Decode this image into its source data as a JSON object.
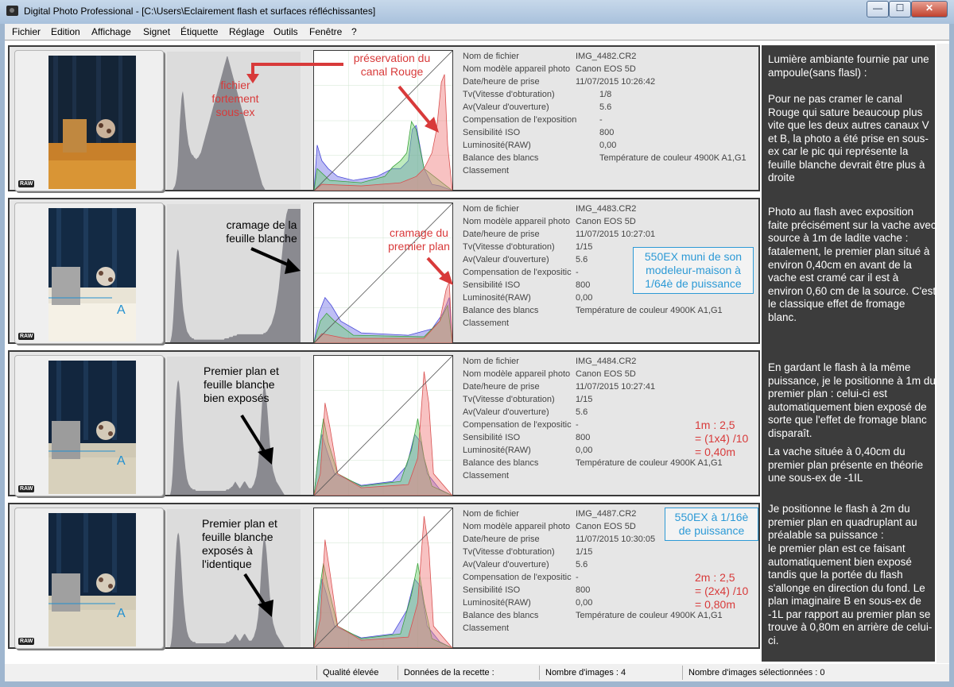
{
  "window": {
    "title": "Digital Photo Professional - [C:\\Users\\Eclairement flash et surfaces réfléchissantes]"
  },
  "window_controls": {
    "minimize": "—",
    "maximize": "☐",
    "close": "✕"
  },
  "menu": [
    "Fichier",
    "Edition",
    "Affichage",
    "Signet",
    "Étiquette",
    "Réglage",
    "Outils",
    "Fenêtre",
    "?"
  ],
  "labels": {
    "file": "Nom de fichier",
    "model": "Nom modèle appareil photo",
    "date": "Date/heure de prise",
    "tv": "Tv(Vitesse d'obturation)",
    "av": "Av(Valeur d'ouverture)",
    "comp_full": "Compensation de l'exposition",
    "comp_short": "Compensation de l'expositic",
    "iso": "Sensibilité ISO",
    "lum": "Luminosité(RAW)",
    "wb": "Balance des blancs",
    "rating": "Classement"
  },
  "raw_badge": "RAW",
  "marker_letter": "A",
  "images": [
    {
      "file": "IMG_4482.CR2",
      "model": "Canon EOS 5D",
      "date": "11/07/2015 10:26:42",
      "tv": "1/8",
      "av": "5.6",
      "comp": "-",
      "iso": "800",
      "lum": "0,00",
      "wb": "Température de couleur 4900K A1,G1",
      "rating": "",
      "ann_hist1": "fichier fortement sous-ex",
      "ann_hist2": "préservation du canal Rouge"
    },
    {
      "file": "IMG_4483.CR2",
      "model": "Canon EOS 5D",
      "date": "11/07/2015 10:27:01",
      "tv": "1/15",
      "av": "5.6",
      "comp": "-",
      "iso": "800",
      "lum": "0,00",
      "wb": "Température de couleur 4900K A1,G1",
      "rating": "",
      "ann_hist1": "cramage de la feuille blanche",
      "ann_hist2": "cramage du premier plan",
      "box_note": "550EX muni de son modeleur-maison à 1/64è de puissance"
    },
    {
      "file": "IMG_4484.CR2",
      "model": "Canon EOS 5D",
      "date": "11/07/2015 10:27:41",
      "tv": "1/15",
      "av": "5.6",
      "comp": "-",
      "iso": "800",
      "lum": "0,00",
      "wb": "Température de couleur 4900K A1,G1",
      "rating": "",
      "ann_hist1": "Premier plan et feuille blanche bien exposés",
      "calc": [
        "1m : 2,5",
        "= (1x4) /10",
        "= 0,40m"
      ]
    },
    {
      "file": "IMG_4487.CR2",
      "model": "Canon EOS 5D",
      "date": "11/07/2015 10:30:05",
      "tv": "1/15",
      "av": "5.6",
      "comp": "-",
      "iso": "800",
      "lum": "0,00",
      "wb": "Température de couleur 4900K A1,G1",
      "rating": "",
      "ann_hist1": "Premier plan et feuille blanche exposés à l'identique",
      "box_note": "550EX à 1/16è de puissance",
      "calc": [
        "2m : 2,5",
        "= (2x4) /10",
        "= 0,80m"
      ]
    }
  ],
  "notes": [
    "Lumière ambiante fournie par une ampoule(sans flasl) :",
    "Pour ne pas cramer le canal Rouge qui sature beaucoup plus vite que les deux autres canaux V et B, la photo a été prise en sous-ex car le pic qui représente la feuille blanche devrait être plus à droite",
    "Photo au flash avec exposition faite précisément sur la vache avec source à 1m de ladite vache :",
    "fatalement, le premier plan situé à environ 0,40cm en avant de la vache est cramé car il est à environ 0,60 cm de la source. C'est le classique effet de fromage blanc.",
    "En gardant le flash à la même puissance, je le positionne à 1m du premier plan : celui-ci est automatiquement bien exposé de sorte que l'effet de fromage blanc disparaît.",
    "La vache située à 0,40cm du premier plan présente en théorie une sous-ex de -1IL",
    "Je positionne le flash à 2m du premier plan en quadruplant au préalable sa puissance :",
    "le premier plan est ce faisant automatiquement bien exposé tandis que la portée du flash s'allonge en direction du fond. Le plan imaginaire B en sous-ex de -1L par rapport au premier plan se trouve à 0,80m en arrière de celui-ci."
  ],
  "status": {
    "quality": "Qualité élevée",
    "recipe": "Données de la recette :",
    "count": "Nombre d'images : 4",
    "selected": "Nombre d'images sélectionnées : 0"
  },
  "colors": {
    "annotation_red": "#d83a3a",
    "annotation_blue": "#2d9ad6",
    "panel_bg": "#3c3c3c"
  },
  "histograms": {
    "luminance": [
      [
        0,
        0,
        0,
        0,
        0,
        0,
        0,
        0,
        0,
        1,
        2,
        3,
        5,
        8,
        12,
        18,
        28,
        40,
        52,
        60,
        68,
        72,
        74,
        70,
        64,
        58,
        52,
        46,
        42,
        38,
        34,
        32,
        30,
        28,
        27,
        26,
        26,
        25,
        24,
        24,
        23,
        23,
        24,
        24,
        25,
        26,
        27,
        28,
        30,
        32,
        34,
        36,
        38,
        40,
        42,
        44,
        46,
        48,
        50,
        52,
        54,
        56,
        58,
        60,
        62,
        64,
        66,
        68,
        70,
        72,
        74,
        76,
        78,
        80,
        82,
        84,
        86,
        88,
        90,
        92,
        94,
        96,
        98,
        100,
        100,
        98,
        96,
        94,
        92,
        90,
        88,
        86,
        84,
        82,
        80,
        78,
        76,
        74,
        72,
        70,
        68,
        66,
        64,
        62,
        60,
        58,
        56,
        54,
        52,
        50,
        48,
        46,
        44,
        42,
        40,
        38,
        36,
        34,
        32,
        30,
        28,
        26,
        24,
        22,
        20,
        18,
        16,
        14,
        12,
        10,
        8,
        6,
        4,
        3,
        2,
        1,
        0,
        0,
        0,
        0,
        0,
        0,
        0,
        0,
        0,
        0,
        0,
        0,
        0,
        0,
        0,
        0,
        0,
        0,
        0,
        0,
        0,
        0,
        0,
        0,
        0,
        0,
        0,
        0,
        0,
        0,
        0,
        0,
        0,
        0,
        0,
        0,
        0,
        0,
        0,
        0,
        0,
        0,
        0,
        0,
        0,
        0,
        0,
        0,
        0,
        0
      ],
      [
        0,
        0,
        0,
        0,
        0,
        2,
        5,
        10,
        18,
        28,
        40,
        52,
        62,
        68,
        70,
        68,
        62,
        54,
        46,
        38,
        30,
        24,
        20,
        16,
        13,
        10,
        8,
        7,
        6,
        5,
        4,
        4,
        3,
        3,
        3,
        2,
        2,
        2,
        2,
        2,
        2,
        2,
        2,
        2,
        2,
        2,
        2,
        2,
        2,
        2,
        2,
        2,
        2,
        2,
        2,
        2,
        2,
        2,
        2,
        2,
        2,
        2,
        2,
        2,
        2,
        2,
        2,
        2,
        2,
        2,
        2,
        2,
        2,
        2,
        3,
        3,
        3,
        3,
        3,
        3,
        4,
        4,
        4,
        4,
        4,
        5,
        5,
        5,
        5,
        5,
        6,
        6,
        6,
        6,
        6,
        6,
        6,
        6,
        6,
        6,
        6,
        6,
        6,
        6,
        6,
        6,
        6,
        6,
        6,
        6,
        6,
        6,
        6,
        6,
        6,
        6,
        6,
        6,
        6,
        6,
        6,
        6,
        6,
        6,
        7,
        7,
        7,
        8,
        8,
        9,
        10,
        11,
        12,
        13,
        14,
        16,
        18,
        20,
        22,
        25,
        28,
        32,
        36,
        40,
        46,
        52,
        58,
        64,
        70,
        76,
        82,
        88,
        92,
        96,
        98,
        100,
        100,
        100,
        100,
        100,
        100,
        100,
        100,
        100,
        100,
        100,
        100,
        100,
        100,
        100,
        100,
        100
      ],
      [
        0,
        0,
        0,
        0,
        0,
        3,
        8,
        16,
        28,
        42,
        56,
        68,
        78,
        84,
        86,
        84,
        78,
        70,
        60,
        50,
        40,
        32,
        26,
        20,
        16,
        12,
        10,
        8,
        7,
        6,
        5,
        5,
        4,
        4,
        4,
        4,
        3,
        3,
        3,
        3,
        3,
        3,
        3,
        3,
        3,
        3,
        3,
        3,
        3,
        3,
        3,
        3,
        3,
        3,
        3,
        3,
        3,
        3,
        3,
        3,
        3,
        3,
        3,
        3,
        3,
        3,
        3,
        3,
        3,
        3,
        3,
        3,
        3,
        3,
        4,
        4,
        4,
        4,
        5,
        5,
        6,
        6,
        7,
        8,
        9,
        10,
        9,
        8,
        7,
        6,
        5,
        5,
        6,
        7,
        8,
        9,
        10,
        10,
        9,
        8,
        7,
        6,
        5,
        5,
        5,
        5,
        6,
        7,
        8,
        10,
        12,
        14,
        18,
        22,
        28,
        36,
        46,
        56,
        66,
        74,
        80,
        82,
        80,
        76,
        70,
        62,
        54,
        46,
        38,
        32,
        26,
        22,
        18,
        16,
        14,
        12,
        10,
        9,
        8,
        7,
        6,
        5,
        4,
        3,
        2,
        1,
        0,
        0,
        0,
        0,
        0,
        0,
        0,
        0,
        0,
        0,
        0,
        0,
        0,
        0,
        0,
        0,
        0,
        0,
        0,
        0,
        0
      ],
      [
        0,
        0,
        0,
        0,
        0,
        3,
        8,
        16,
        28,
        42,
        56,
        68,
        78,
        84,
        86,
        84,
        78,
        70,
        60,
        50,
        40,
        32,
        26,
        20,
        16,
        12,
        10,
        8,
        7,
        6,
        5,
        5,
        4,
        4,
        4,
        4,
        3,
        3,
        3,
        3,
        3,
        3,
        3,
        3,
        3,
        3,
        3,
        3,
        3,
        3,
        3,
        3,
        3,
        3,
        3,
        3,
        3,
        3,
        3,
        3,
        3,
        3,
        3,
        3,
        3,
        3,
        3,
        3,
        3,
        3,
        3,
        3,
        3,
        3,
        4,
        4,
        4,
        4,
        5,
        5,
        6,
        6,
        7,
        8,
        9,
        10,
        9,
        8,
        7,
        6,
        5,
        5,
        6,
        7,
        8,
        9,
        10,
        10,
        9,
        8,
        7,
        6,
        5,
        5,
        5,
        5,
        6,
        7,
        8,
        10,
        12,
        14,
        18,
        22,
        28,
        36,
        46,
        56,
        66,
        74,
        80,
        82,
        80,
        76,
        70,
        62,
        54,
        46,
        38,
        32,
        26,
        22,
        18,
        16,
        14,
        12,
        10,
        9,
        8,
        7,
        6,
        5,
        4,
        3,
        2,
        1,
        0,
        0,
        0,
        0,
        0,
        0,
        0,
        0,
        0,
        0,
        0,
        0,
        0,
        0,
        0,
        0,
        0,
        0,
        0,
        0,
        0
      ]
    ]
  }
}
